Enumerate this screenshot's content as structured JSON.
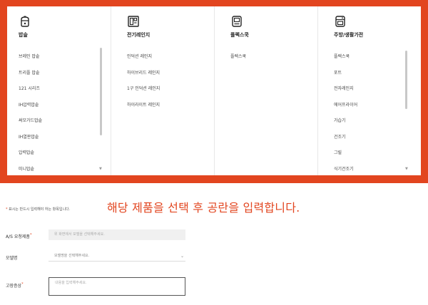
{
  "categories": [
    {
      "icon": "rice-cooker-icon",
      "title": "밥솥",
      "items": [
        "브레인 밥솥",
        "트리플 밥솥",
        "121 시리즈",
        "IH압력밥솥",
        "써모가드밥솥",
        "IH열판밥솥",
        "압력밥솥",
        "미니밥솥"
      ]
    },
    {
      "icon": "electric-range-icon",
      "title": "전기레인지",
      "items": [
        "인덕션 레인지",
        "하이브리드 레인지",
        "1구 인덕션 레인지",
        "하이라이트 레인지"
      ]
    },
    {
      "icon": "multi-cooker-icon",
      "title": "플렉스쿡",
      "items": [
        "플렉스쿡"
      ]
    },
    {
      "icon": "kitchen-appliance-icon",
      "title": "주방/생활가전",
      "items": [
        "플렉스쿡",
        "포트",
        "전자레인지",
        "에어프라이어",
        "가습기",
        "건조기",
        "그릴",
        "식기건조기"
      ]
    }
  ],
  "required_note": "표시는 반드시 입력해야 하는 항목입니다.",
  "required_star": "*",
  "instruction": "해당 제품을 선택 후 공란을 입력합니다.",
  "form": {
    "model_label": "A/S 요청제품",
    "model_placeholder": "위 화면에서 모델을 선택해주세요.",
    "name_label": "모델명",
    "name_placeholder": "모델명을 선택해주세요.",
    "symptom_label": "고장증상",
    "symptom_placeholder": "내용을 입력해주세요."
  },
  "colors": {
    "accent": "#e2451f"
  }
}
